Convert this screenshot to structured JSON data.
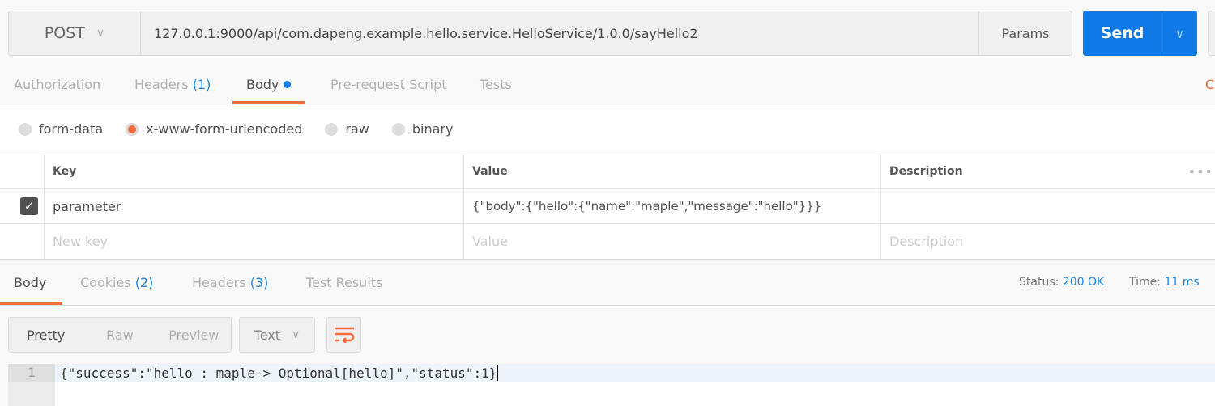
{
  "request": {
    "method": "POST",
    "url": "127.0.0.1:9000/api/com.dapeng.example.hello.service.HelloService/1.0.0/sayHello2",
    "params_label": "Params",
    "send_label": "Send"
  },
  "tabs": [
    {
      "label": "Authorization"
    },
    {
      "label": "Headers",
      "count": "(1)"
    },
    {
      "label": "Body"
    },
    {
      "label": "Pre-request Script"
    },
    {
      "label": "Tests"
    }
  ],
  "right_link": "C",
  "body_types": [
    "form-data",
    "x-www-form-urlencoded",
    "raw",
    "binary"
  ],
  "selected_body_type": "x-www-form-urlencoded",
  "table": {
    "headers": [
      "Key",
      "Value",
      "Description"
    ],
    "rows": [
      {
        "checked": true,
        "key": "parameter",
        "value": "{\"body\":{\"hello\":{\"name\":\"maple\",\"message\":\"hello\"}}}",
        "description": ""
      }
    ],
    "placeholders": {
      "key": "New key",
      "value": "Value",
      "description": "Description"
    }
  },
  "response": {
    "tabs": [
      {
        "label": "Body"
      },
      {
        "label": "Cookies",
        "count": "(2)"
      },
      {
        "label": "Headers",
        "count": "(3)"
      },
      {
        "label": "Test Results"
      }
    ],
    "status_label": "Status:",
    "status": "200 OK",
    "time_label": "Time:",
    "time": "11 ms",
    "views": [
      "Pretty",
      "Raw",
      "Preview"
    ],
    "format": "Text",
    "line_number": "1",
    "code": "{\"success\":\"hello : maple-> Optional[hello]\",\"status\":1}"
  },
  "colors": {
    "accent": "#f26b3a",
    "send": "#0f7ae5",
    "link": "#1c87e5"
  }
}
